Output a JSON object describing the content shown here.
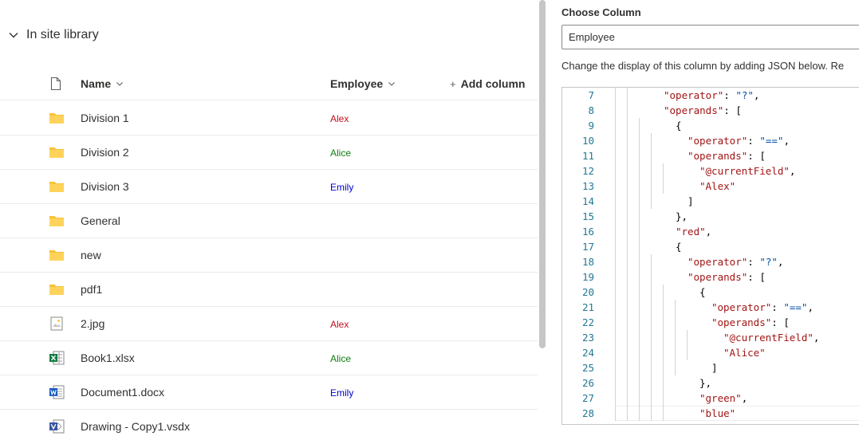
{
  "library": {
    "group_label": "In site library",
    "columns": {
      "name": "Name",
      "employee": "Employee",
      "add_column": "Add column"
    },
    "rows": [
      {
        "name": "Division 1",
        "type": "folder",
        "employee": "Alex",
        "employee_color": "#c50f1f"
      },
      {
        "name": "Division 2",
        "type": "folder",
        "employee": "Alice",
        "employee_color": "#107c10"
      },
      {
        "name": "Division 3",
        "type": "folder",
        "employee": "Emily",
        "employee_color": "#0000cd"
      },
      {
        "name": "General",
        "type": "folder",
        "employee": "",
        "employee_color": "#323130"
      },
      {
        "name": "new",
        "type": "folder",
        "employee": "",
        "employee_color": "#323130"
      },
      {
        "name": "pdf1",
        "type": "folder",
        "employee": "",
        "employee_color": "#323130"
      },
      {
        "name": "2.jpg",
        "type": "image",
        "employee": "Alex",
        "employee_color": "#c50f1f"
      },
      {
        "name": "Book1.xlsx",
        "type": "excel",
        "employee": "Alice",
        "employee_color": "#107c10"
      },
      {
        "name": "Document1.docx",
        "type": "word",
        "employee": "Emily",
        "employee_color": "#0000cd"
      },
      {
        "name": "Drawing - Copy1.vsdx",
        "type": "visio",
        "employee": "",
        "employee_color": "#323130"
      }
    ]
  },
  "format_panel": {
    "choose_label": "Choose Column",
    "selected_column": "Employee",
    "help_text": "Change the display of this column by adding JSON below. Re"
  },
  "code_editor": {
    "lines": [
      {
        "num": "7",
        "indent": 1,
        "key": "\"operator\"",
        "sep": ": ",
        "val": "\"?\"",
        "tail": ","
      },
      {
        "num": "8",
        "indent": 1,
        "key": "\"operands\"",
        "sep": ": ",
        "val": "",
        "tail": "["
      },
      {
        "num": "9",
        "indent": 2,
        "key": "",
        "sep": "",
        "val": "",
        "tail": "{"
      },
      {
        "num": "10",
        "indent": 3,
        "key": "\"operator\"",
        "sep": ": ",
        "val": "\"==\"",
        "tail": ","
      },
      {
        "num": "11",
        "indent": 3,
        "key": "\"operands\"",
        "sep": ": ",
        "val": "",
        "tail": "["
      },
      {
        "num": "12",
        "indent": 4,
        "key": "\"@currentField\"",
        "sep": "",
        "val": "",
        "tail": ","
      },
      {
        "num": "13",
        "indent": 4,
        "key": "\"Alex\"",
        "sep": "",
        "val": "",
        "tail": ""
      },
      {
        "num": "14",
        "indent": 3,
        "key": "",
        "sep": "",
        "val": "",
        "tail": "]"
      },
      {
        "num": "15",
        "indent": 2,
        "key": "",
        "sep": "",
        "val": "",
        "tail": "},"
      },
      {
        "num": "16",
        "indent": 2,
        "key": "\"red\"",
        "sep": "",
        "val": "",
        "tail": ","
      },
      {
        "num": "17",
        "indent": 2,
        "key": "",
        "sep": "",
        "val": "",
        "tail": "{"
      },
      {
        "num": "18",
        "indent": 3,
        "key": "\"operator\"",
        "sep": ": ",
        "val": "\"?\"",
        "tail": ","
      },
      {
        "num": "19",
        "indent": 3,
        "key": "\"operands\"",
        "sep": ": ",
        "val": "",
        "tail": "["
      },
      {
        "num": "20",
        "indent": 4,
        "key": "",
        "sep": "",
        "val": "",
        "tail": "{"
      },
      {
        "num": "21",
        "indent": 5,
        "key": "\"operator\"",
        "sep": ": ",
        "val": "\"==\"",
        "tail": ","
      },
      {
        "num": "22",
        "indent": 5,
        "key": "\"operands\"",
        "sep": ": ",
        "val": "",
        "tail": "["
      },
      {
        "num": "23",
        "indent": 6,
        "key": "\"@currentField\"",
        "sep": "",
        "val": "",
        "tail": ","
      },
      {
        "num": "24",
        "indent": 6,
        "key": "\"Alice\"",
        "sep": "",
        "val": "",
        "tail": ""
      },
      {
        "num": "25",
        "indent": 5,
        "key": "",
        "sep": "",
        "val": "",
        "tail": "]"
      },
      {
        "num": "26",
        "indent": 4,
        "key": "",
        "sep": "",
        "val": "",
        "tail": "},"
      },
      {
        "num": "27",
        "indent": 4,
        "key": "\"green\"",
        "sep": "",
        "val": "",
        "tail": ","
      },
      {
        "num": "28",
        "indent": 4,
        "key": "\"blue\"",
        "sep": "",
        "val": "",
        "tail": ""
      }
    ]
  },
  "icons": {
    "group_toggle": "chevron-down-icon",
    "type_header": "document-icon",
    "sort": "chevron-down-icon",
    "add": "plus-icon",
    "folder": "folder-icon",
    "image": "image-file-icon",
    "excel": "excel-file-icon",
    "word": "word-file-icon",
    "visio": "visio-file-icon"
  },
  "colors": {
    "folder": "#f8c13a",
    "excel": "#107c41",
    "word": "#185abd",
    "visio": "#3955a3",
    "line_number": "#237893",
    "json_key": "#a31515",
    "json_value": "#0451a5"
  }
}
